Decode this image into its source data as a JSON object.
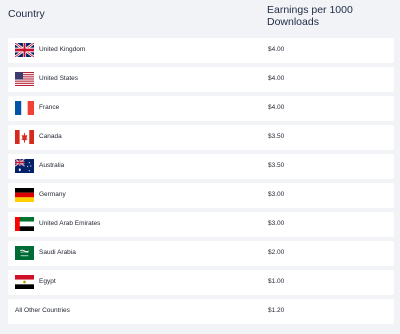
{
  "table": {
    "header_country": "Country",
    "header_earnings": "Earnings per 1000 Downloads",
    "rows": [
      {
        "country": "United Kingdom",
        "earnings": "$4.00",
        "flag": "uk-flag-icon"
      },
      {
        "country": "United States",
        "earnings": "$4.00",
        "flag": "us-flag-icon"
      },
      {
        "country": "France",
        "earnings": "$4.00",
        "flag": "france-flag-icon"
      },
      {
        "country": "Canada",
        "earnings": "$3.50",
        "flag": "canada-flag-icon"
      },
      {
        "country": "Australia",
        "earnings": "$3.50",
        "flag": "australia-flag-icon"
      },
      {
        "country": "Germany",
        "earnings": "$3.00",
        "flag": "germany-flag-icon"
      },
      {
        "country": "United Arab Emirates",
        "earnings": "$3.00",
        "flag": "uae-flag-icon"
      },
      {
        "country": "Saudi Arabia",
        "earnings": "$2.00",
        "flag": "saudi-arabia-flag-icon"
      },
      {
        "country": "Egypt",
        "earnings": "$1.00",
        "flag": "egypt-flag-icon"
      },
      {
        "country": "All Other Countries",
        "earnings": "$1.20",
        "flag": ""
      }
    ]
  }
}
